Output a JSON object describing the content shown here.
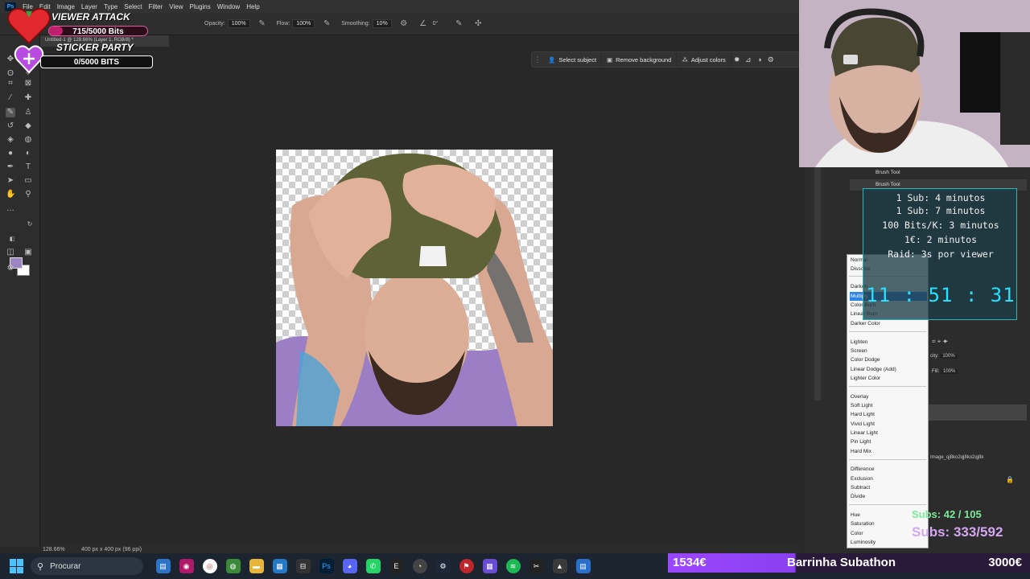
{
  "menu": {
    "items": [
      "File",
      "Edit",
      "Image",
      "Layer",
      "Type",
      "Select",
      "Filter",
      "View",
      "Plugins",
      "Window",
      "Help"
    ]
  },
  "options": {
    "opacity_label": "Opacity:",
    "opacity_value": "100%",
    "flow_label": "Flow:",
    "flow_value": "100%",
    "smoothing_label": "Smoothing:",
    "smoothing_value": "10%",
    "angle_value": "0°"
  },
  "doc_tab": "Untitled-1 @ 128.66% (Layer 1, RGB/8) *",
  "task_bar": {
    "select_subject": "Select subject",
    "remove_background": "Remove background",
    "adjust_colors": "Adjust colors"
  },
  "status": {
    "zoom": "128.66%",
    "doc_size": "400 px x 400 px (96 ppi)"
  },
  "history": {
    "items": [
      "Brush Tool",
      "Brush Tool"
    ]
  },
  "blend_modes": {
    "groups": [
      [
        "Normal",
        "Dissolve"
      ],
      [
        "Darken",
        "Multiply",
        "Color Burn",
        "Linear Burn",
        "Darker Color"
      ],
      [
        "Lighten",
        "Screen",
        "Color Dodge",
        "Linear Dodge (Add)",
        "Lighter Color"
      ],
      [
        "Overlay",
        "Soft Light",
        "Hard Light",
        "Vivid Light",
        "Linear Light",
        "Pin Light",
        "Hard Mix"
      ],
      [
        "Difference",
        "Exclusion",
        "Subtract",
        "Divide"
      ],
      [
        "Hue",
        "Saturation",
        "Color",
        "Luminosity"
      ]
    ],
    "selected": "Multiply"
  },
  "layers": {
    "opacity_label": "city:",
    "opacity_value": "100%",
    "fill_label": "Fill:",
    "fill_value": "100%",
    "layer_name": "Image_qj8ko2qj8ko2qj8k"
  },
  "timer": {
    "lines": [
      "1 Sub: 4 minutos",
      "1 Sub: 7 minutos",
      "100 Bits/K: 3 minutos",
      "1€: 2 minutos",
      "Raid: 3s por viewer"
    ],
    "clock": "11 : 51 : 31"
  },
  "subs": {
    "line1": "Subs: 42 / 105",
    "line2": "Subs: 333/592"
  },
  "alerts": {
    "viewer_attack_title": "VIEWER ATTACK",
    "viewer_attack_bar": "715/5000 Bits",
    "sticker_title": "STICKER PARTY",
    "sticker_bar": "0/5000 BITS"
  },
  "viewer_attack_progress": 0.143,
  "sticker_progress": 0.0,
  "subathon": {
    "left_amount": "1534€",
    "label": "Barrinha Subathon",
    "right_amount": "3000€"
  },
  "taskbar": {
    "search_placeholder": "Procurar"
  },
  "colors": {
    "accent_cyan": "#29e1ff",
    "fg_swatch": "#9b86c2",
    "selection_blue": "#2e84ea"
  }
}
